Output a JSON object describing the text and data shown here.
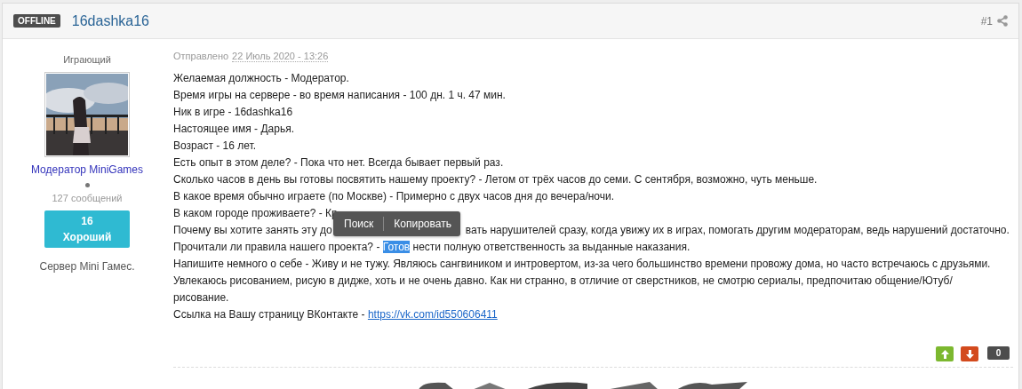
{
  "post": {
    "status_badge": "OFFLINE",
    "author": "16dashka16",
    "post_number": "#1",
    "user": {
      "rank": "Играющий",
      "group": "Модератор MiniGames",
      "online": false,
      "post_count": "127 сообщений",
      "reputation": {
        "value": "16",
        "label": "Хороший"
      },
      "custom_field": "Сервер Mini Гамес."
    },
    "posted_label": "Отправлено",
    "posted_date": "22 Июль 2020 - 13:26",
    "lines": [
      {
        "segments": [
          {
            "kind": "text",
            "text": "Желаемая должность - Модератор."
          }
        ]
      },
      {
        "segments": [
          {
            "kind": "text",
            "text": "Время игры на сервере - во время написания - 100 дн. 1 ч. 47 мин."
          }
        ]
      },
      {
        "segments": [
          {
            "kind": "text",
            "text": "Ник в игре - 16dashka16"
          }
        ]
      },
      {
        "segments": [
          {
            "kind": "text",
            "text": "Настоящее имя - Дарья."
          }
        ]
      },
      {
        "segments": [
          {
            "kind": "text",
            "text": "Возраст - 16 лет."
          }
        ]
      },
      {
        "segments": [
          {
            "kind": "text",
            "text": "Есть опыт в этом деле? - Пока что нет. Всегда бывает первый раз."
          }
        ]
      },
      {
        "segments": [
          {
            "kind": "text",
            "text": "Сколько часов в день вы готовы посвятить нашему проекту? - Летом от трёх часов до семи. С сентября, возможно, чуть меньше."
          }
        ]
      },
      {
        "segments": [
          {
            "kind": "text",
            "text": "В какое время обычно играете (по Москве) - Примерно с двух часов дня до вечера/ночи."
          }
        ]
      },
      {
        "segments": [
          {
            "kind": "text",
            "text": "В каком городе проживаете? - Кр"
          }
        ]
      },
      {
        "segments": [
          {
            "kind": "text",
            "text": "Почему вы хотите занять эту до"
          },
          {
            "kind": "covered"
          },
          {
            "kind": "text",
            "text": "вать нарушителей сразу, когда увижу их в играх, помогать другим модераторам, ведь нарушений достаточно."
          }
        ]
      },
      {
        "segments": [
          {
            "kind": "text",
            "text": "Прочитали ли правила нашего проекта? - "
          },
          {
            "kind": "selection",
            "text": "Готов"
          },
          {
            "kind": "text",
            "text": " нести полную ответственность за выданные наказания."
          }
        ]
      },
      {
        "segments": [
          {
            "kind": "text",
            "text": "Напишите немного о себе - Живу и не тужу. Являюсь сангвиником и интровертом, из-за чего большинство времени провожу дома, но часто встречаюсь с друзьями."
          }
        ]
      },
      {
        "segments": [
          {
            "kind": "text",
            "text": "Увлекаюсь рисованием, рисую в дидже, хоть и не очень давно. Как ни странно, в отличие от сверстников, не смотрю сериалы, предпочитаю общение/Ютуб/"
          }
        ]
      },
      {
        "segments": [
          {
            "kind": "text",
            "text": "рисование."
          }
        ]
      }
    ],
    "link_line": {
      "text": "Ссылка на Вашу страницу ВКонтакте - ",
      "link": "https://vk.com/id550606411"
    },
    "votes": {
      "score": "0"
    }
  },
  "context_menu": {
    "items": [
      "Поиск",
      "Копировать"
    ]
  }
}
